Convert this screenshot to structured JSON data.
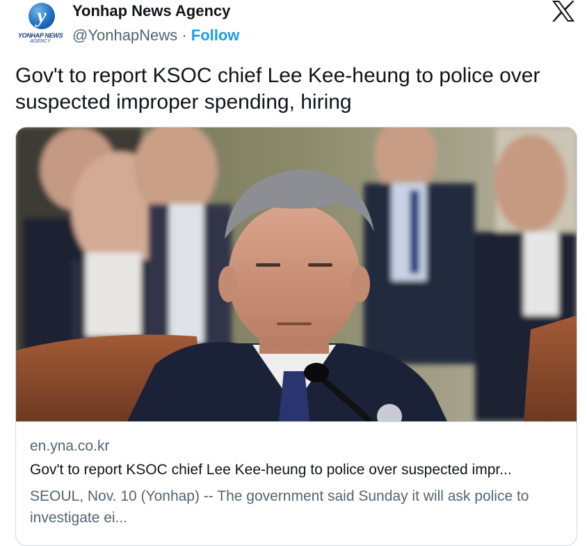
{
  "account": {
    "name": "Yonhap News Agency",
    "handle": "@YonhapNews",
    "separator": "·",
    "follow_label": "Follow",
    "avatar_letter": "y",
    "avatar_text_line1": "YONHAP NEWS",
    "avatar_text_line2": "AGENCY",
    "avatar_icon": "yonhap-logo"
  },
  "platform_icon": "x-logo-icon",
  "tweet": {
    "text": "Gov't to report KSOC chief Lee Kee-heung to police over suspected improper spending, hiring"
  },
  "link_card": {
    "image_alt": "photo of a man in a suit at a hearing",
    "domain": "en.yna.co.kr",
    "title": "Gov't to report KSOC chief Lee Kee-heung to police over suspected impr...",
    "description": "SEOUL, Nov. 10 (Yonhap) -- The government said Sunday it will ask police to investigate ei..."
  },
  "colors": {
    "link_blue": "#1d9bf0",
    "secondary_text": "#536471",
    "primary_text": "#0f1419",
    "border": "#cfd9de"
  }
}
